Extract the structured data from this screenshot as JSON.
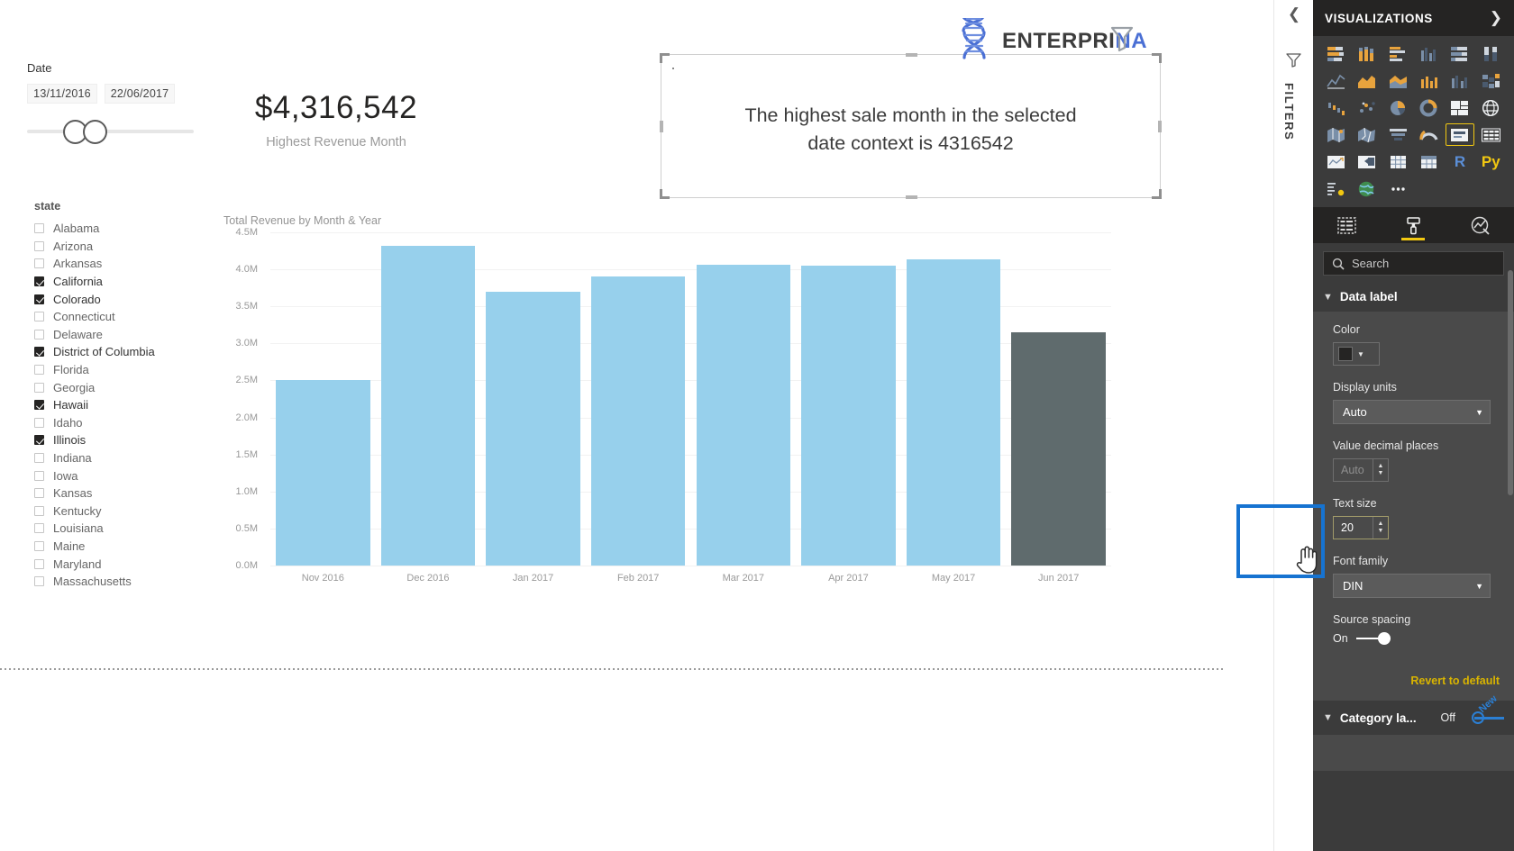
{
  "canvas": {
    "date_slicer": {
      "title": "Date",
      "start": "13/11/2016",
      "end": "22/06/2017"
    },
    "state_slicer": {
      "header": "state",
      "items": [
        {
          "label": "Alabama",
          "checked": false
        },
        {
          "label": "Arizona",
          "checked": false
        },
        {
          "label": "Arkansas",
          "checked": false
        },
        {
          "label": "California",
          "checked": true
        },
        {
          "label": "Colorado",
          "checked": true
        },
        {
          "label": "Connecticut",
          "checked": false
        },
        {
          "label": "Delaware",
          "checked": false
        },
        {
          "label": "District of Columbia",
          "checked": true
        },
        {
          "label": "Florida",
          "checked": false
        },
        {
          "label": "Georgia",
          "checked": false
        },
        {
          "label": "Hawaii",
          "checked": true
        },
        {
          "label": "Idaho",
          "checked": false
        },
        {
          "label": "Illinois",
          "checked": true
        },
        {
          "label": "Indiana",
          "checked": false
        },
        {
          "label": "Iowa",
          "checked": false
        },
        {
          "label": "Kansas",
          "checked": false
        },
        {
          "label": "Kentucky",
          "checked": false
        },
        {
          "label": "Louisiana",
          "checked": false
        },
        {
          "label": "Maine",
          "checked": false
        },
        {
          "label": "Maryland",
          "checked": false
        },
        {
          "label": "Massachusetts",
          "checked": false
        }
      ]
    },
    "kpi_card": {
      "value": "$4,316,542",
      "label": "Highest Revenue Month"
    },
    "text_visual": {
      "line1": "The highest sale month in the selected",
      "line2": "date context is 4316542",
      "selected": true
    },
    "brand": {
      "name": "ENTERPRI",
      "tail": "NA",
      "logo_icon": "dna-helix-icon"
    }
  },
  "chart_data": {
    "type": "bar",
    "title": "Total Revenue by Month & Year",
    "xlabel": "",
    "ylabel": "",
    "ylim": [
      0,
      4500000
    ],
    "grid": true,
    "legend": null,
    "categories": [
      "Nov 2016",
      "Dec 2016",
      "Jan 2017",
      "Feb 2017",
      "Mar 2017",
      "Apr 2017",
      "May 2017",
      "Jun 2017"
    ],
    "values": [
      2500000,
      4316542,
      3700000,
      3900000,
      4060000,
      4050000,
      4140000,
      3150000
    ],
    "ytick_labels": [
      "4.5M",
      "4.0M",
      "3.5M",
      "3.0M",
      "2.5M",
      "2.0M",
      "1.5M",
      "1.0M",
      "0.5M",
      "0.0M"
    ],
    "ytick_values": [
      4500000,
      4000000,
      3500000,
      3000000,
      2500000,
      2000000,
      1500000,
      1000000,
      500000,
      0
    ],
    "bar_color": "#97d0ec",
    "highlight_color": "#5f6b6d",
    "highlighted_index": 7
  },
  "filters_rail": {
    "label": "FILTERS",
    "collapse_icon": "chevron-left-icon",
    "funnel_icon": "filter-funnel-icon"
  },
  "visualizations_pane": {
    "header": {
      "title": "VISUALIZATIONS",
      "expand_icon": "chevron-right-icon"
    },
    "icons": [
      "stacked-bar-chart-icon",
      "stacked-column-chart-icon",
      "clustered-bar-chart-icon",
      "clustered-column-chart-icon",
      "100-stacked-bar-chart-icon",
      "100-stacked-column-chart-icon",
      "line-chart-icon",
      "area-chart-icon",
      "stacked-area-chart-icon",
      "line-stacked-column-chart-icon",
      "line-clustered-column-chart-icon",
      "ribbon-chart-icon",
      "waterfall-chart-icon",
      "scatter-chart-icon",
      "pie-chart-icon",
      "donut-chart-icon",
      "treemap-icon",
      "map-icon",
      "filled-map-icon",
      "shape-map-icon",
      "funnel-chart-icon",
      "gauge-chart-icon",
      "card-icon",
      "multi-row-card-icon",
      "kpi-icon",
      "slicer-icon",
      "table-icon",
      "matrix-icon",
      "r-script-visual-icon",
      "python-visual-icon",
      "key-influencers-icon",
      "arcgis-map-icon",
      "more-options-icon"
    ],
    "selected_icon_index": 22,
    "tabs": [
      "fields-tab-icon",
      "format-tab-icon",
      "analytics-tab-icon"
    ],
    "active_tab": 1,
    "search": {
      "placeholder": "Search",
      "icon": "search-icon"
    },
    "format": {
      "section_title": "Data label",
      "color_label": "Color",
      "color_value": "#252423",
      "display_units_label": "Display units",
      "display_units_value": "Auto",
      "value_decimal_label": "Value decimal places",
      "value_decimal_value": "Auto",
      "text_size_label": "Text size",
      "text_size_value": "20",
      "font_family_label": "Font family",
      "font_family_value": "DIN",
      "source_spacing_label": "Source spacing",
      "source_spacing_state": "On",
      "revert_label": "Revert to default",
      "next_section_title": "Category la...",
      "next_section_state": "Off",
      "annotation": "New"
    },
    "highlight_color": "#1673d1"
  }
}
